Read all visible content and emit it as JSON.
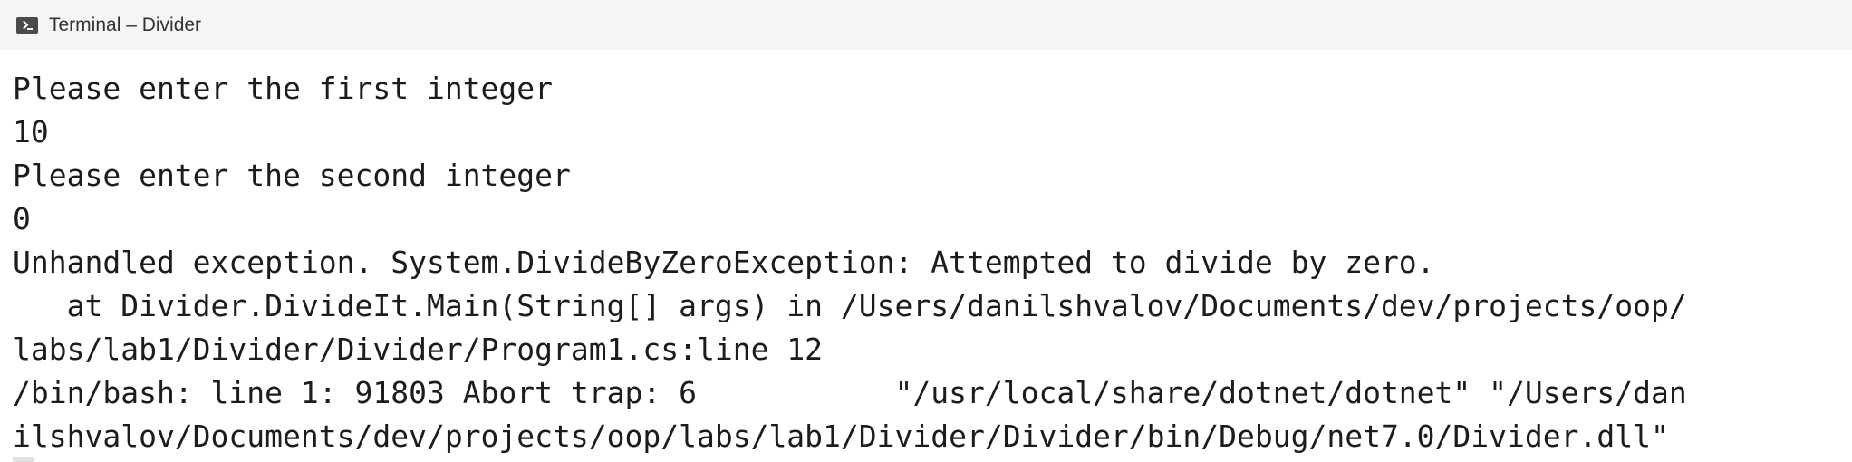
{
  "window": {
    "title": "Terminal – Divider",
    "icon": "terminal-icon"
  },
  "terminal": {
    "lines": [
      "Please enter the first integer",
      "10",
      "Please enter the second integer",
      "0",
      "Unhandled exception. System.DivideByZeroException: Attempted to divide by zero.",
      "   at Divider.DivideIt.Main(String[] args) in /Users/danilshvalov/Documents/dev/projects/oop/",
      "labs/lab1/Divider/Divider/Program1.cs:line 12",
      "/bin/bash: line 1: 91803 Abort trap: 6           \"/usr/local/share/dotnet/dotnet\" \"/Users/dan",
      "ilshvalov/Documents/dev/projects/oop/labs/lab1/Divider/Divider/bin/Debug/net7.0/Divider.dll\""
    ]
  }
}
